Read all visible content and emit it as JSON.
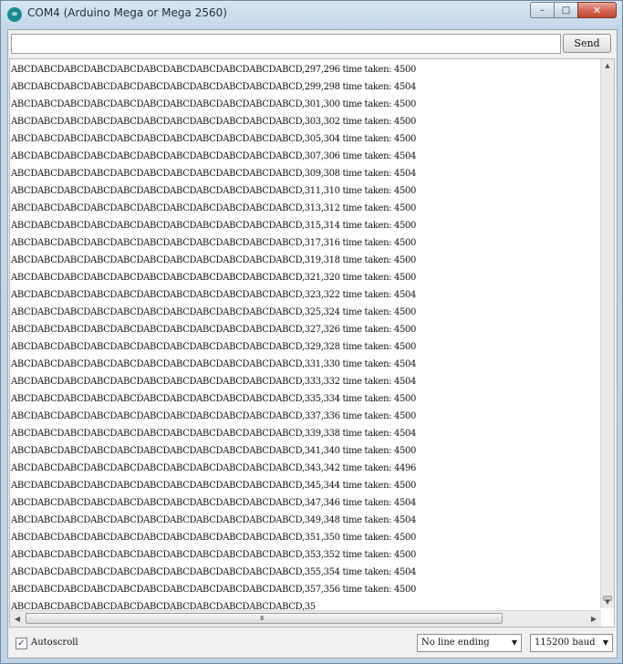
{
  "window": {
    "title": "COM4 (Arduino Mega or Mega 2560)",
    "icon_text": "∞",
    "controls": {
      "minimize": "–",
      "maximize": "□",
      "close": "✕"
    }
  },
  "send": {
    "input_value": "",
    "button_label": "Send"
  },
  "output_lines": [
    "ABCDABCDABCDABCDABCDABCDABCDABCDABCDABCDABCD,297,296 time taken: 4500",
    "ABCDABCDABCDABCDABCDABCDABCDABCDABCDABCDABCD,299,298 time taken: 4504",
    "ABCDABCDABCDABCDABCDABCDABCDABCDABCDABCDABCD,301,300 time taken: 4500",
    "ABCDABCDABCDABCDABCDABCDABCDABCDABCDABCDABCD,303,302 time taken: 4500",
    "ABCDABCDABCDABCDABCDABCDABCDABCDABCDABCDABCD,305,304 time taken: 4500",
    "ABCDABCDABCDABCDABCDABCDABCDABCDABCDABCDABCD,307,306 time taken: 4504",
    "ABCDABCDABCDABCDABCDABCDABCDABCDABCDABCDABCD,309,308 time taken: 4504",
    "ABCDABCDABCDABCDABCDABCDABCDABCDABCDABCDABCD,311,310 time taken: 4500",
    "ABCDABCDABCDABCDABCDABCDABCDABCDABCDABCDABCD,313,312 time taken: 4500",
    "ABCDABCDABCDABCDABCDABCDABCDABCDABCDABCDABCD,315,314 time taken: 4500",
    "ABCDABCDABCDABCDABCDABCDABCDABCDABCDABCDABCD,317,316 time taken: 4500",
    "ABCDABCDABCDABCDABCDABCDABCDABCDABCDABCDABCD,319,318 time taken: 4500",
    "ABCDABCDABCDABCDABCDABCDABCDABCDABCDABCDABCD,321,320 time taken: 4500",
    "ABCDABCDABCDABCDABCDABCDABCDABCDABCDABCDABCD,323,322 time taken: 4504",
    "ABCDABCDABCDABCDABCDABCDABCDABCDABCDABCDABCD,325,324 time taken: 4500",
    "ABCDABCDABCDABCDABCDABCDABCDABCDABCDABCDABCD,327,326 time taken: 4500",
    "ABCDABCDABCDABCDABCDABCDABCDABCDABCDABCDABCD,329,328 time taken: 4500",
    "ABCDABCDABCDABCDABCDABCDABCDABCDABCDABCDABCD,331,330 time taken: 4504",
    "ABCDABCDABCDABCDABCDABCDABCDABCDABCDABCDABCD,333,332 time taken: 4504",
    "ABCDABCDABCDABCDABCDABCDABCDABCDABCDABCDABCD,335,334 time taken: 4500",
    "ABCDABCDABCDABCDABCDABCDABCDABCDABCDABCDABCD,337,336 time taken: 4500",
    "ABCDABCDABCDABCDABCDABCDABCDABCDABCDABCDABCD,339,338 time taken: 4504",
    "ABCDABCDABCDABCDABCDABCDABCDABCDABCDABCDABCD,341,340 time taken: 4500",
    "ABCDABCDABCDABCDABCDABCDABCDABCDABCDABCDABCD,343,342 time taken: 4496",
    "ABCDABCDABCDABCDABCDABCDABCDABCDABCDABCDABCD,345,344 time taken: 4500",
    "ABCDABCDABCDABCDABCDABCDABCDABCDABCDABCDABCD,347,346 time taken: 4504",
    "ABCDABCDABCDABCDABCDABCDABCDABCDABCDABCDABCD,349,348 time taken: 4504",
    "ABCDABCDABCDABCDABCDABCDABCDABCDABCDABCDABCD,351,350 time taken: 4500",
    "ABCDABCDABCDABCDABCDABCDABCDABCDABCDABCDABCD,353,352 time taken: 4500",
    "ABCDABCDABCDABCDABCDABCDABCDABCDABCDABCDABCD,355,354 time taken: 4504",
    "ABCDABCDABCDABCDABCDABCDABCDABCDABCDABCDABCD,357,356 time taken: 4500",
    "ABCDABCDABCDABCDABCDABCDABCDABCDABCDABCDABCD,35"
  ],
  "scroll": {
    "up_arrow": "▲",
    "down_arrow": "▼",
    "left_arrow": "◀",
    "right_arrow": "▶",
    "grip": "III"
  },
  "footer": {
    "autoscroll_label": "Autoscroll",
    "autoscroll_checked": true,
    "autoscroll_mark": "✓",
    "line_ending": "No line ending",
    "baud": "115200 baud",
    "caret": "▼"
  }
}
